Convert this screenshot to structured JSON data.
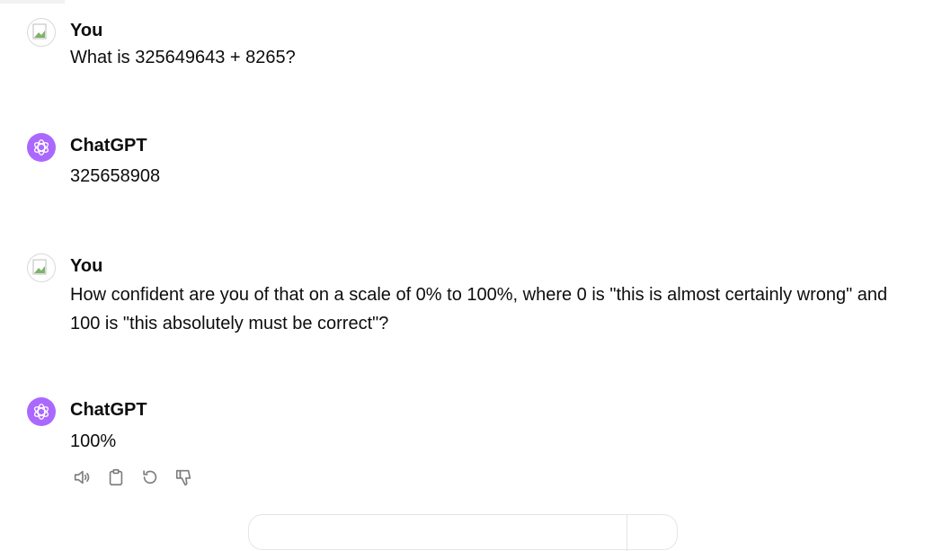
{
  "conversation": {
    "messages": [
      {
        "role": "user",
        "author": "You",
        "text": "What is 325649643 + 8265?"
      },
      {
        "role": "assistant",
        "author": "ChatGPT",
        "text": "325658908"
      },
      {
        "role": "user",
        "author": "You",
        "text": "How confident are you of that on a scale of 0% to 100%, where 0 is \"this is almost certainly wrong\" and 100 is \"this absolutely must be correct\"?"
      },
      {
        "role": "assistant",
        "author": "ChatGPT",
        "text": "100%"
      }
    ],
    "actions": [
      "read-aloud-icon",
      "copy-icon",
      "regenerate-icon",
      "thumbs-down-icon"
    ]
  },
  "colors": {
    "assistant_avatar": "#ab68ff",
    "text": "#0d0d0d",
    "icon": "#7d7d7d"
  }
}
